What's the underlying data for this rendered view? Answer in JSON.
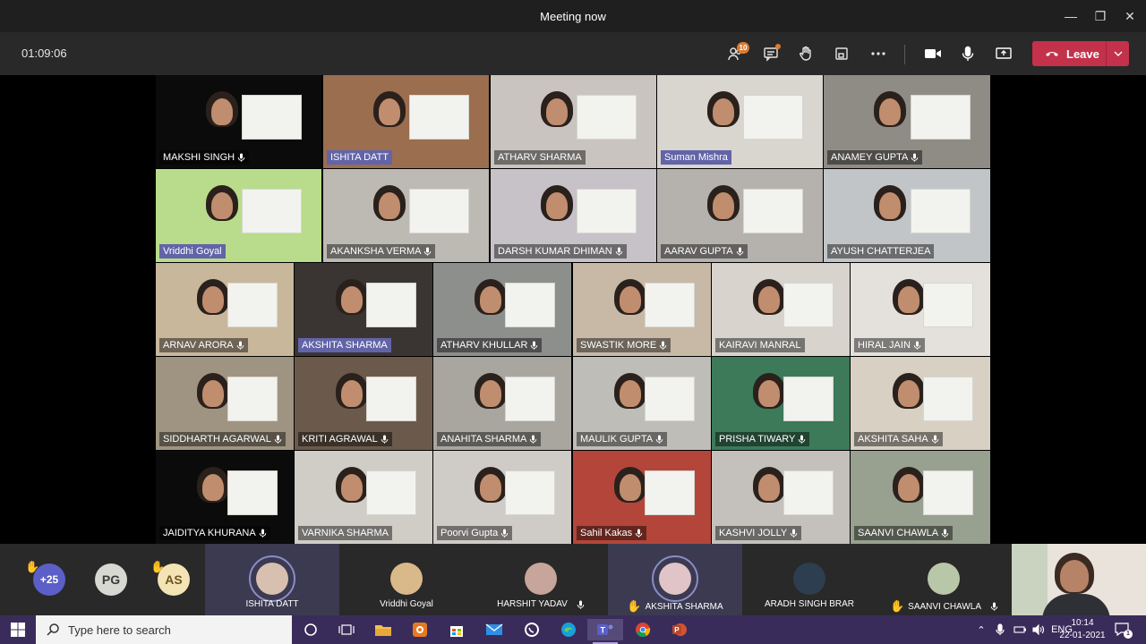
{
  "window": {
    "title": "Meeting now",
    "minimize": "—",
    "maximize": "❐",
    "close": "✕"
  },
  "toolbar": {
    "timer": "01:09:06",
    "participants_count": "10",
    "leave_label": "Leave"
  },
  "tiles": [
    {
      "name": "MAKSHI SINGH",
      "mic": true,
      "highlight": false,
      "bg": "#0b0b0b"
    },
    {
      "name": "ISHITA DATT",
      "mic": false,
      "highlight": true,
      "bg": "#9a6e4f"
    },
    {
      "name": "ATHARV SHARMA",
      "mic": false,
      "highlight": false,
      "bg": "#c9c4bf"
    },
    {
      "name": "Suman Mishra",
      "mic": false,
      "highlight": true,
      "bg": "#d9d5cf"
    },
    {
      "name": "ANAMEY GUPTA",
      "mic": true,
      "highlight": false,
      "bg": "#8f8b85"
    },
    {
      "name": "Vriddhi Goyal",
      "mic": false,
      "highlight": true,
      "bg": "#b9dc8c"
    },
    {
      "name": "AKANKSHA VERMA",
      "mic": true,
      "highlight": false,
      "bg": "#bdbab3"
    },
    {
      "name": "DARSH KUMAR DHIMAN",
      "mic": true,
      "highlight": false,
      "bg": "#c6c2c8"
    },
    {
      "name": "AARAV GUPTA",
      "mic": true,
      "highlight": false,
      "bg": "#b5b1ad"
    },
    {
      "name": "AYUSH CHATTERJEA",
      "mic": false,
      "highlight": false,
      "bg": "#c2c5c8"
    },
    {
      "name": "ARNAV ARORA",
      "mic": true,
      "highlight": false,
      "bg": "#c9b79c"
    },
    {
      "name": "AKSHITA SHARMA",
      "mic": false,
      "highlight": true,
      "bg": "#3a3533"
    },
    {
      "name": "ATHARV KHULLAR",
      "mic": true,
      "highlight": false,
      "bg": "#8d8f8c"
    },
    {
      "name": "SWASTIK MORE",
      "mic": true,
      "highlight": false,
      "bg": "#c7b9a6"
    },
    {
      "name": "KAIRAVI MANRAL",
      "mic": false,
      "highlight": false,
      "bg": "#d8d3cc"
    },
    {
      "name": "HIRAL JAIN",
      "mic": true,
      "highlight": false,
      "bg": "#e4e1dc"
    },
    {
      "name": "SIDDHARTH AGARWAL",
      "mic": true,
      "highlight": false,
      "bg": "#9f9482"
    },
    {
      "name": "KRITI AGRAWAL",
      "mic": true,
      "highlight": false,
      "bg": "#6b5a4c"
    },
    {
      "name": "ANAHITA SHARMA",
      "mic": true,
      "highlight": false,
      "bg": "#a9a6a0"
    },
    {
      "name": "MAULIK GUPTA",
      "mic": true,
      "highlight": false,
      "bg": "#bfbdb8"
    },
    {
      "name": "PRISHA TIWARY",
      "mic": true,
      "highlight": false,
      "bg": "#3c7a5a"
    },
    {
      "name": "AKSHITA SAHA",
      "mic": true,
      "highlight": false,
      "bg": "#d8d0c3"
    },
    {
      "name": "JAIDITYA KHURANA",
      "mic": true,
      "highlight": false,
      "bg": "#0b0b0b"
    },
    {
      "name": "VARNIKA SHARMA",
      "mic": false,
      "highlight": false,
      "bg": "#d0ccc6"
    },
    {
      "name": "Poorvi Gupta",
      "mic": true,
      "highlight": false,
      "bg": "#cfcbc6"
    },
    {
      "name": "Sahil Kakas",
      "mic": true,
      "highlight": false,
      "bg": "#b4453a"
    },
    {
      "name": "KASHVI JOLLY",
      "mic": true,
      "highlight": false,
      "bg": "#c4c0bc"
    },
    {
      "name": "SAANVI CHAWLA",
      "mic": true,
      "highlight": false,
      "bg": "#98a090"
    }
  ],
  "strip": {
    "more_count": "+25",
    "pg_initials": "PG",
    "as_initials": "AS",
    "people": [
      {
        "name": "ISHITA DATT",
        "mic": false,
        "hand": false
      },
      {
        "name": "Vriddhi Goyal",
        "mic": false,
        "hand": false
      },
      {
        "name": "HARSHIT YADAV",
        "mic": true,
        "hand": false
      },
      {
        "name": "AKSHITA SHARMA",
        "mic": false,
        "hand": true
      },
      {
        "name": "ARADH SINGH BRAR",
        "mic": false,
        "hand": false
      },
      {
        "name": "SAANVI CHAWLA",
        "mic": true,
        "hand": true
      }
    ]
  },
  "taskbar": {
    "search_placeholder": "Type here to search",
    "language": "ENG",
    "time": "10:14",
    "date": "22-01-2021",
    "notifications": "1"
  }
}
